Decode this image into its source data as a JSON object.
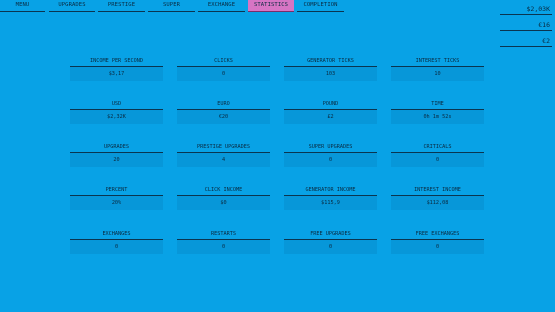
{
  "nav": {
    "tabs": [
      {
        "label": "MENU"
      },
      {
        "label": "UPGRADES"
      },
      {
        "label": "PRESTIGE"
      },
      {
        "label": "SUPER"
      },
      {
        "label": "EXCHANGE"
      },
      {
        "label": "STATISTICS",
        "active": true
      },
      {
        "label": "COMPLETION"
      }
    ]
  },
  "currencies": {
    "dollars": "$2,03K",
    "euros": "€16",
    "pounds": "€2"
  },
  "stats": [
    {
      "label": "INCOME PER SECOND",
      "value": "$3,17"
    },
    {
      "label": "CLICKS",
      "value": "0"
    },
    {
      "label": "GENERATOR TICKS",
      "value": "103"
    },
    {
      "label": "INTEREST TICKS",
      "value": "10"
    },
    {
      "label": "USD",
      "value": "$2,32K"
    },
    {
      "label": "EURO",
      "value": "€20"
    },
    {
      "label": "POUND",
      "value": "£2"
    },
    {
      "label": "TIME",
      "value": "0h 1m 52s"
    },
    {
      "label": "UPGRADES",
      "value": "20"
    },
    {
      "label": "PRESTIGE UPGRADES",
      "value": "4"
    },
    {
      "label": "SUPER UPGRADES",
      "value": "0"
    },
    {
      "label": "CRITICALS",
      "value": "0"
    },
    {
      "label": "PERCENT",
      "value": "20%"
    },
    {
      "label": "CLICK INCOME",
      "value": "$0"
    },
    {
      "label": "GENERATOR INCOME",
      "value": "$115,9"
    },
    {
      "label": "INTEREST INCOME",
      "value": "$112,08"
    },
    {
      "label": "EXCHANGES",
      "value": "0"
    },
    {
      "label": "RESTARTS",
      "value": "0"
    },
    {
      "label": "FREE UPGRADES",
      "value": "0"
    },
    {
      "label": "FREE EXCHANGES",
      "value": "0"
    }
  ],
  "colors": {
    "background": "#08a2e6",
    "active_tab": "#d775c4",
    "text": "#0a2a40"
  }
}
